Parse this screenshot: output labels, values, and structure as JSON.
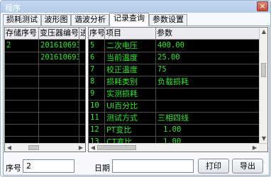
{
  "window": {
    "title": "程序",
    "close_label": "×"
  },
  "tabs": [
    "损耗测试",
    "波形图",
    "谐波分析",
    "记录查询",
    "参数设置"
  ],
  "active_tab": "记录查询",
  "left_table": {
    "headers": [
      "存储序号",
      "变压器编号",
      "进"
    ],
    "rows": [
      [
        "2",
        "201610693",
        ""
      ],
      [
        "",
        "201610693",
        ""
      ]
    ]
  },
  "right_table": {
    "headers": [
      "序号",
      "项目",
      "参数"
    ],
    "rows": [
      [
        "5",
        "二次电压",
        "400.00"
      ],
      [
        "6",
        "当前温度",
        "25.00"
      ],
      [
        "7",
        "校正温度",
        "75"
      ],
      [
        "8",
        "损耗类别",
        "负载损耗"
      ],
      [
        "9",
        "实测损耗",
        ""
      ],
      [
        "10",
        "UI百分比",
        ""
      ],
      [
        "11",
        "测试方式",
        "三相四线"
      ],
      [
        "12",
        "PT变比",
        "1.00"
      ],
      [
        "13",
        "CT变比",
        "1.00"
      ]
    ]
  },
  "bottom": {
    "seq_label": "序号",
    "seq_value": "2",
    "date_label": "日期",
    "date_value": "",
    "print_label": "打印",
    "export_label": "导出"
  },
  "colors": {
    "cell_text": "#2ee82e",
    "grid_bg": "#000000"
  }
}
